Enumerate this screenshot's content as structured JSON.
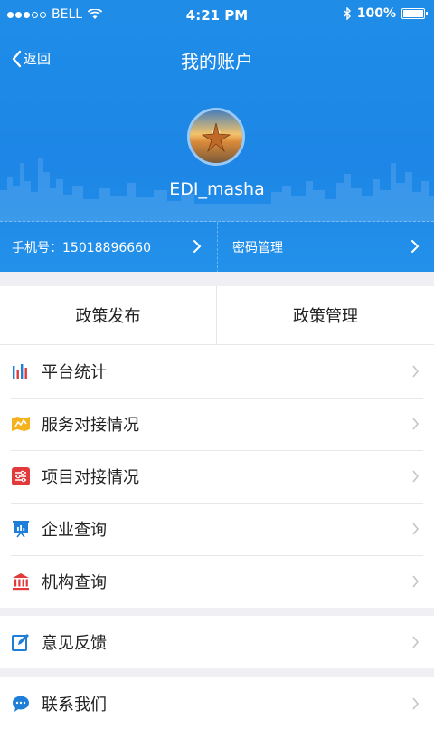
{
  "status_bar": {
    "carrier": "BELL",
    "time": "4:21 PM",
    "battery": "100%"
  },
  "navbar": {
    "back_label": "返回",
    "title": "我的账户"
  },
  "profile": {
    "username": "EDI_masha"
  },
  "account": {
    "phone_label": "手机号：15018896660",
    "password_label": "密码管理"
  },
  "tabs": {
    "left": "政策发布",
    "right": "政策管理"
  },
  "menu": {
    "items": [
      {
        "label": "平台统计",
        "icon": "bar-chart-icon"
      },
      {
        "label": "服务对接情况",
        "icon": "map-icon"
      },
      {
        "label": "项目对接情况",
        "icon": "list-settings-icon"
      },
      {
        "label": "企业查询",
        "icon": "presentation-icon"
      },
      {
        "label": "机构查询",
        "icon": "bank-icon"
      }
    ],
    "feedback": {
      "label": "意见反馈",
      "icon": "edit-icon"
    },
    "contact": {
      "label": "联系我们",
      "icon": "chat-icon"
    }
  },
  "colors": {
    "header_blue": "#1d86e6",
    "page_bg": "#efeff4",
    "icon_blue": "#1f7fd8",
    "icon_red": "#e23a3a",
    "icon_yellow": "#f5b21d"
  }
}
